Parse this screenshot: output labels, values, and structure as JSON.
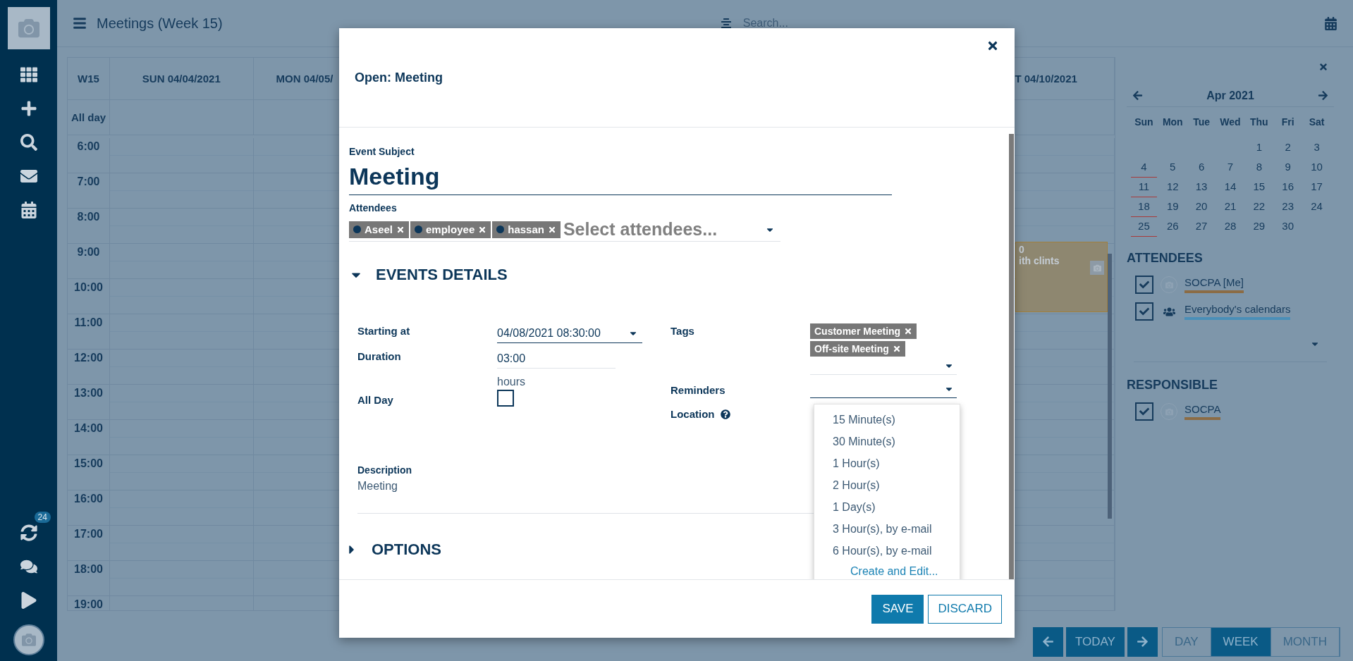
{
  "sidebar": {
    "badge": "24"
  },
  "header": {
    "title": "Meetings (Week 15)",
    "search": {
      "placeholder": "Search..."
    }
  },
  "calendar": {
    "week": "W15",
    "day_headers": [
      "SUN 04/04/2021",
      "MON 04/05/",
      "T 04/10/2021"
    ],
    "all_day": "All day",
    "hours": [
      "6:00",
      "7:00",
      "8:00",
      "9:00",
      "10:00",
      "11:00",
      "12:00",
      "13:00",
      "14:00",
      "15:00",
      "16:00",
      "17:00",
      "18:00",
      "19:00"
    ],
    "event": {
      "lines": [
        "0",
        "ith clints"
      ]
    }
  },
  "right_panel": {
    "month": "Apr 2021",
    "weekdays": [
      "Sun",
      "Mon",
      "Tue",
      "Wed",
      "Thu",
      "Fri",
      "Sat"
    ],
    "weeks": [
      [
        "1",
        "2",
        "3"
      ],
      [
        "4",
        "5",
        "6",
        "7",
        "8",
        "9",
        "10"
      ],
      [
        "11",
        "12",
        "13",
        "14",
        "15",
        "16",
        "17"
      ],
      [
        "18",
        "19",
        "20",
        "21",
        "22",
        "23",
        "24"
      ],
      [
        "25",
        "26",
        "27",
        "28",
        "29",
        "30"
      ]
    ],
    "attendees_title": "ATTENDEES",
    "attendees": [
      {
        "name": "SOCPA [Me]",
        "checked": true,
        "color": "#8b6c45",
        "kind": "person"
      },
      {
        "name": "Everybody's calendars",
        "checked": true,
        "color": "#4a8fb8",
        "kind": "group"
      }
    ],
    "responsible_title": "RESPONSIBLE",
    "responsible": [
      {
        "name": "SOCPA",
        "checked": true,
        "color": "#8b6c45",
        "kind": "person"
      }
    ]
  },
  "nav": {
    "today": "TODAY",
    "views": [
      {
        "label": "DAY",
        "selected": false
      },
      {
        "label": "WEEK",
        "selected": true
      },
      {
        "label": "MONTH",
        "selected": false
      }
    ]
  },
  "modal": {
    "title": "Open: Meeting",
    "subject_label": "Event Subject",
    "subject": "Meeting",
    "attendees_label": "Attendees",
    "attendees": [
      "Aseel",
      "employee",
      "hassan"
    ],
    "attendees_placeholder": "Select attendees...",
    "sections": [
      {
        "title": "EVENTS DETAILS",
        "expanded": true
      },
      {
        "title": "OPTIONS",
        "expanded": false
      }
    ],
    "starting_at": {
      "label": "Starting at",
      "value": "04/08/2021 08:30:00"
    },
    "duration": {
      "label": "Duration",
      "value": "03:00",
      "unit": "hours"
    },
    "all_day": {
      "label": "All Day",
      "checked": false
    },
    "tags": {
      "label": "Tags",
      "items": [
        "Customer Meeting",
        "Off-site Meeting"
      ]
    },
    "reminders": {
      "label": "Reminders",
      "options": [
        "15 Minute(s)",
        "30 Minute(s)",
        "1 Hour(s)",
        "2 Hour(s)",
        "1 Day(s)",
        "3 Hour(s), by e-mail",
        "6 Hour(s), by e-mail"
      ],
      "create_link": "Create and Edit..."
    },
    "location": {
      "label": "Location"
    },
    "description": {
      "label": "Description",
      "value": "Meeting"
    },
    "buttons": {
      "save": "SAVE",
      "discard": "DISCARD"
    }
  }
}
